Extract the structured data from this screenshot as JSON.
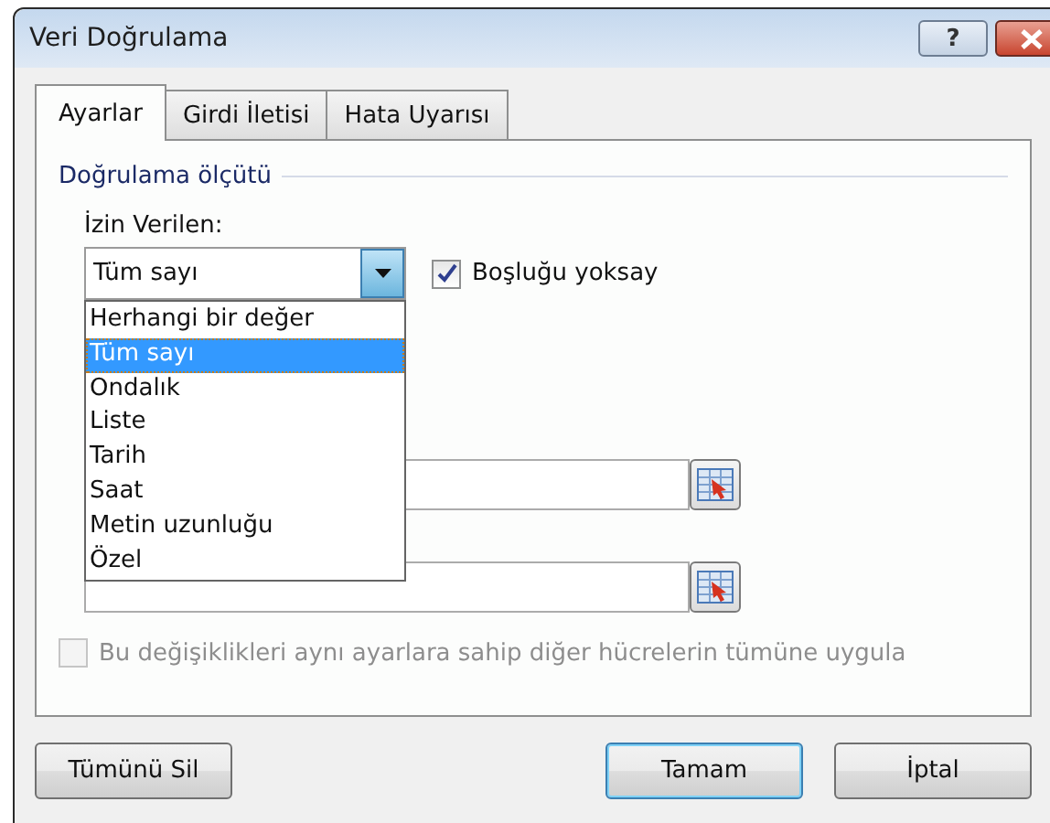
{
  "window": {
    "title": "Veri Doğrulama",
    "help": "?"
  },
  "tabs": [
    {
      "label": "Ayarlar",
      "selected": true
    },
    {
      "label": "Girdi İletisi",
      "selected": false
    },
    {
      "label": "Hata Uyarısı",
      "selected": false
    }
  ],
  "group": "Doğrulama ölçütü",
  "allow": {
    "label": "İzin Verilen:",
    "value": "Tüm sayı",
    "expanded": true,
    "options": [
      {
        "label": "Herhangi bir değer",
        "selected": false
      },
      {
        "label": "Tüm sayı",
        "selected": true
      },
      {
        "label": "Ondalık",
        "selected": false
      },
      {
        "label": "Liste",
        "selected": false
      },
      {
        "label": "Tarih",
        "selected": false
      },
      {
        "label": "Saat",
        "selected": false
      },
      {
        "label": "Metin uzunluğu",
        "selected": false
      },
      {
        "label": "Özel",
        "selected": false
      }
    ]
  },
  "ignore_blank": {
    "label": "Boşluğu yoksay",
    "checked": true
  },
  "apply_all": {
    "label": "Bu değişiklikleri aynı ayarlara sahip diğer hücrelerin tümüne uygula",
    "checked": false,
    "disabled": true
  },
  "buttons": [
    {
      "label": "Tümünü Sil",
      "default": false
    },
    {
      "label": "Tamam",
      "default": true
    },
    {
      "label": "İptal",
      "default": false
    }
  ]
}
